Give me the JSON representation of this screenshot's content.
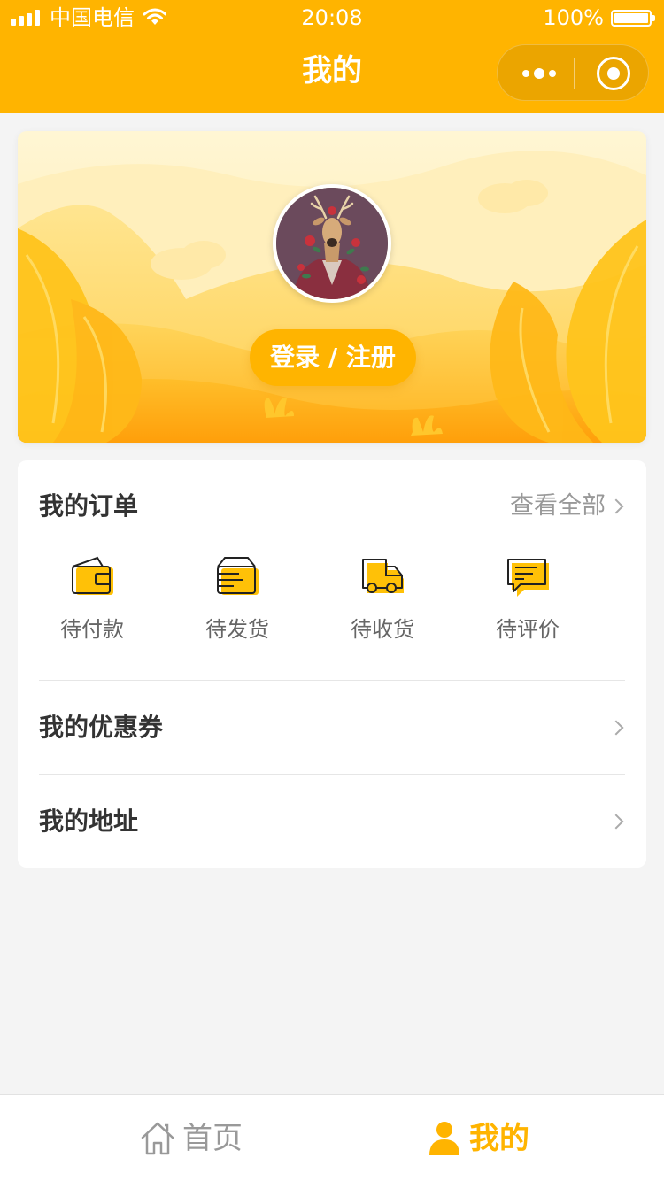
{
  "status_bar": {
    "carrier": "中国电信",
    "time": "20:08",
    "battery": "100%"
  },
  "nav": {
    "title": "我的"
  },
  "profile": {
    "login_label": "登录 / 注册"
  },
  "orders": {
    "title": "我的订单",
    "view_all": "查看全部",
    "statuses": [
      {
        "label": "待付款",
        "icon": "wallet-icon"
      },
      {
        "label": "待发货",
        "icon": "package-icon"
      },
      {
        "label": "待收货",
        "icon": "truck-icon"
      },
      {
        "label": "待评价",
        "icon": "comment-icon"
      }
    ]
  },
  "menu": {
    "coupons": "我的优惠券",
    "address": "我的地址"
  },
  "tab_bar": {
    "items": [
      {
        "label": "首页",
        "icon": "home-icon",
        "active": false
      },
      {
        "label": "我的",
        "icon": "user-icon",
        "active": true
      }
    ]
  },
  "colors": {
    "accent": "#ffb400",
    "background": "#f4f4f4",
    "muted_text": "#999999"
  }
}
